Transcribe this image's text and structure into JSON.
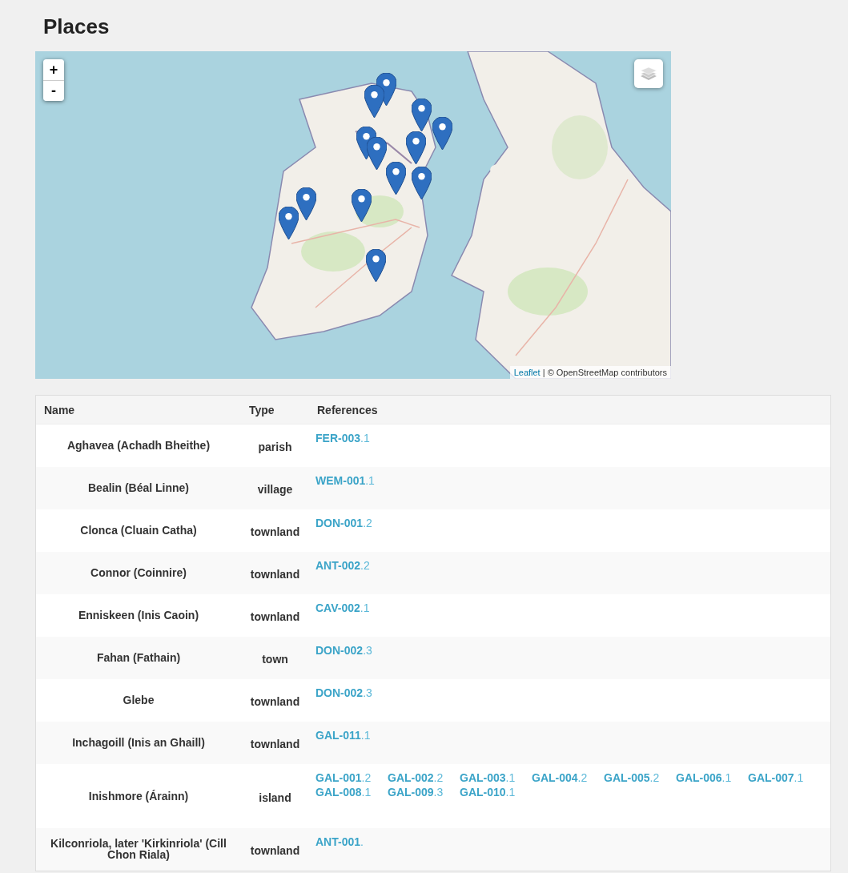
{
  "title": "Places",
  "map": {
    "zoom_in": "+",
    "zoom_out": "-",
    "attribution_link": "Leaflet",
    "attribution_text": "| © OpenStreetMap contributors"
  },
  "table": {
    "columns": [
      "Name",
      "Type",
      "References"
    ],
    "rows": [
      {
        "name": "Aghavea (Achadh Bheithe)",
        "type": "parish",
        "references": [
          {
            "code": "FER-003",
            "suffix": ".1"
          }
        ]
      },
      {
        "name": "Bealin (Béal Linne)",
        "type": "village",
        "references": [
          {
            "code": "WEM-001",
            "suffix": ".1"
          }
        ]
      },
      {
        "name": "Clonca (Cluain Catha)",
        "type": "townland",
        "references": [
          {
            "code": "DON-001",
            "suffix": ".2"
          }
        ]
      },
      {
        "name": "Connor (Coinnire)",
        "type": "townland",
        "references": [
          {
            "code": "ANT-002",
            "suffix": ".2"
          }
        ]
      },
      {
        "name": "Enniskeen (Inis Caoin)",
        "type": "townland",
        "references": [
          {
            "code": "CAV-002",
            "suffix": ".1"
          }
        ]
      },
      {
        "name": "Fahan (Fathain)",
        "type": "town",
        "references": [
          {
            "code": "DON-002",
            "suffix": ".3"
          }
        ]
      },
      {
        "name": "Glebe",
        "type": "townland",
        "references": [
          {
            "code": "DON-002",
            "suffix": ".3"
          }
        ]
      },
      {
        "name": "Inchagoill (Inis an Ghaill)",
        "type": "townland",
        "references": [
          {
            "code": "GAL-011",
            "suffix": ".1"
          }
        ]
      },
      {
        "name": "Inishmore (Árainn)",
        "type": "island",
        "references": [
          {
            "code": "GAL-001",
            "suffix": ".2"
          },
          {
            "code": "GAL-002",
            "suffix": ".2"
          },
          {
            "code": "GAL-003",
            "suffix": ".1"
          },
          {
            "code": "GAL-004",
            "suffix": ".2"
          },
          {
            "code": "GAL-005",
            "suffix": ".2"
          },
          {
            "code": "GAL-006",
            "suffix": ".1"
          },
          {
            "code": "GAL-007",
            "suffix": ".1"
          },
          {
            "code": "GAL-008",
            "suffix": ".1"
          },
          {
            "code": "GAL-009",
            "suffix": ".3"
          },
          {
            "code": "GAL-010",
            "suffix": ".1"
          }
        ]
      },
      {
        "name": "Kilconriola, later 'Kirkinriola' (Cill Chon Riala)",
        "type": "townland",
        "references": [
          {
            "code": "ANT-001",
            "suffix": "."
          }
        ]
      }
    ]
  }
}
